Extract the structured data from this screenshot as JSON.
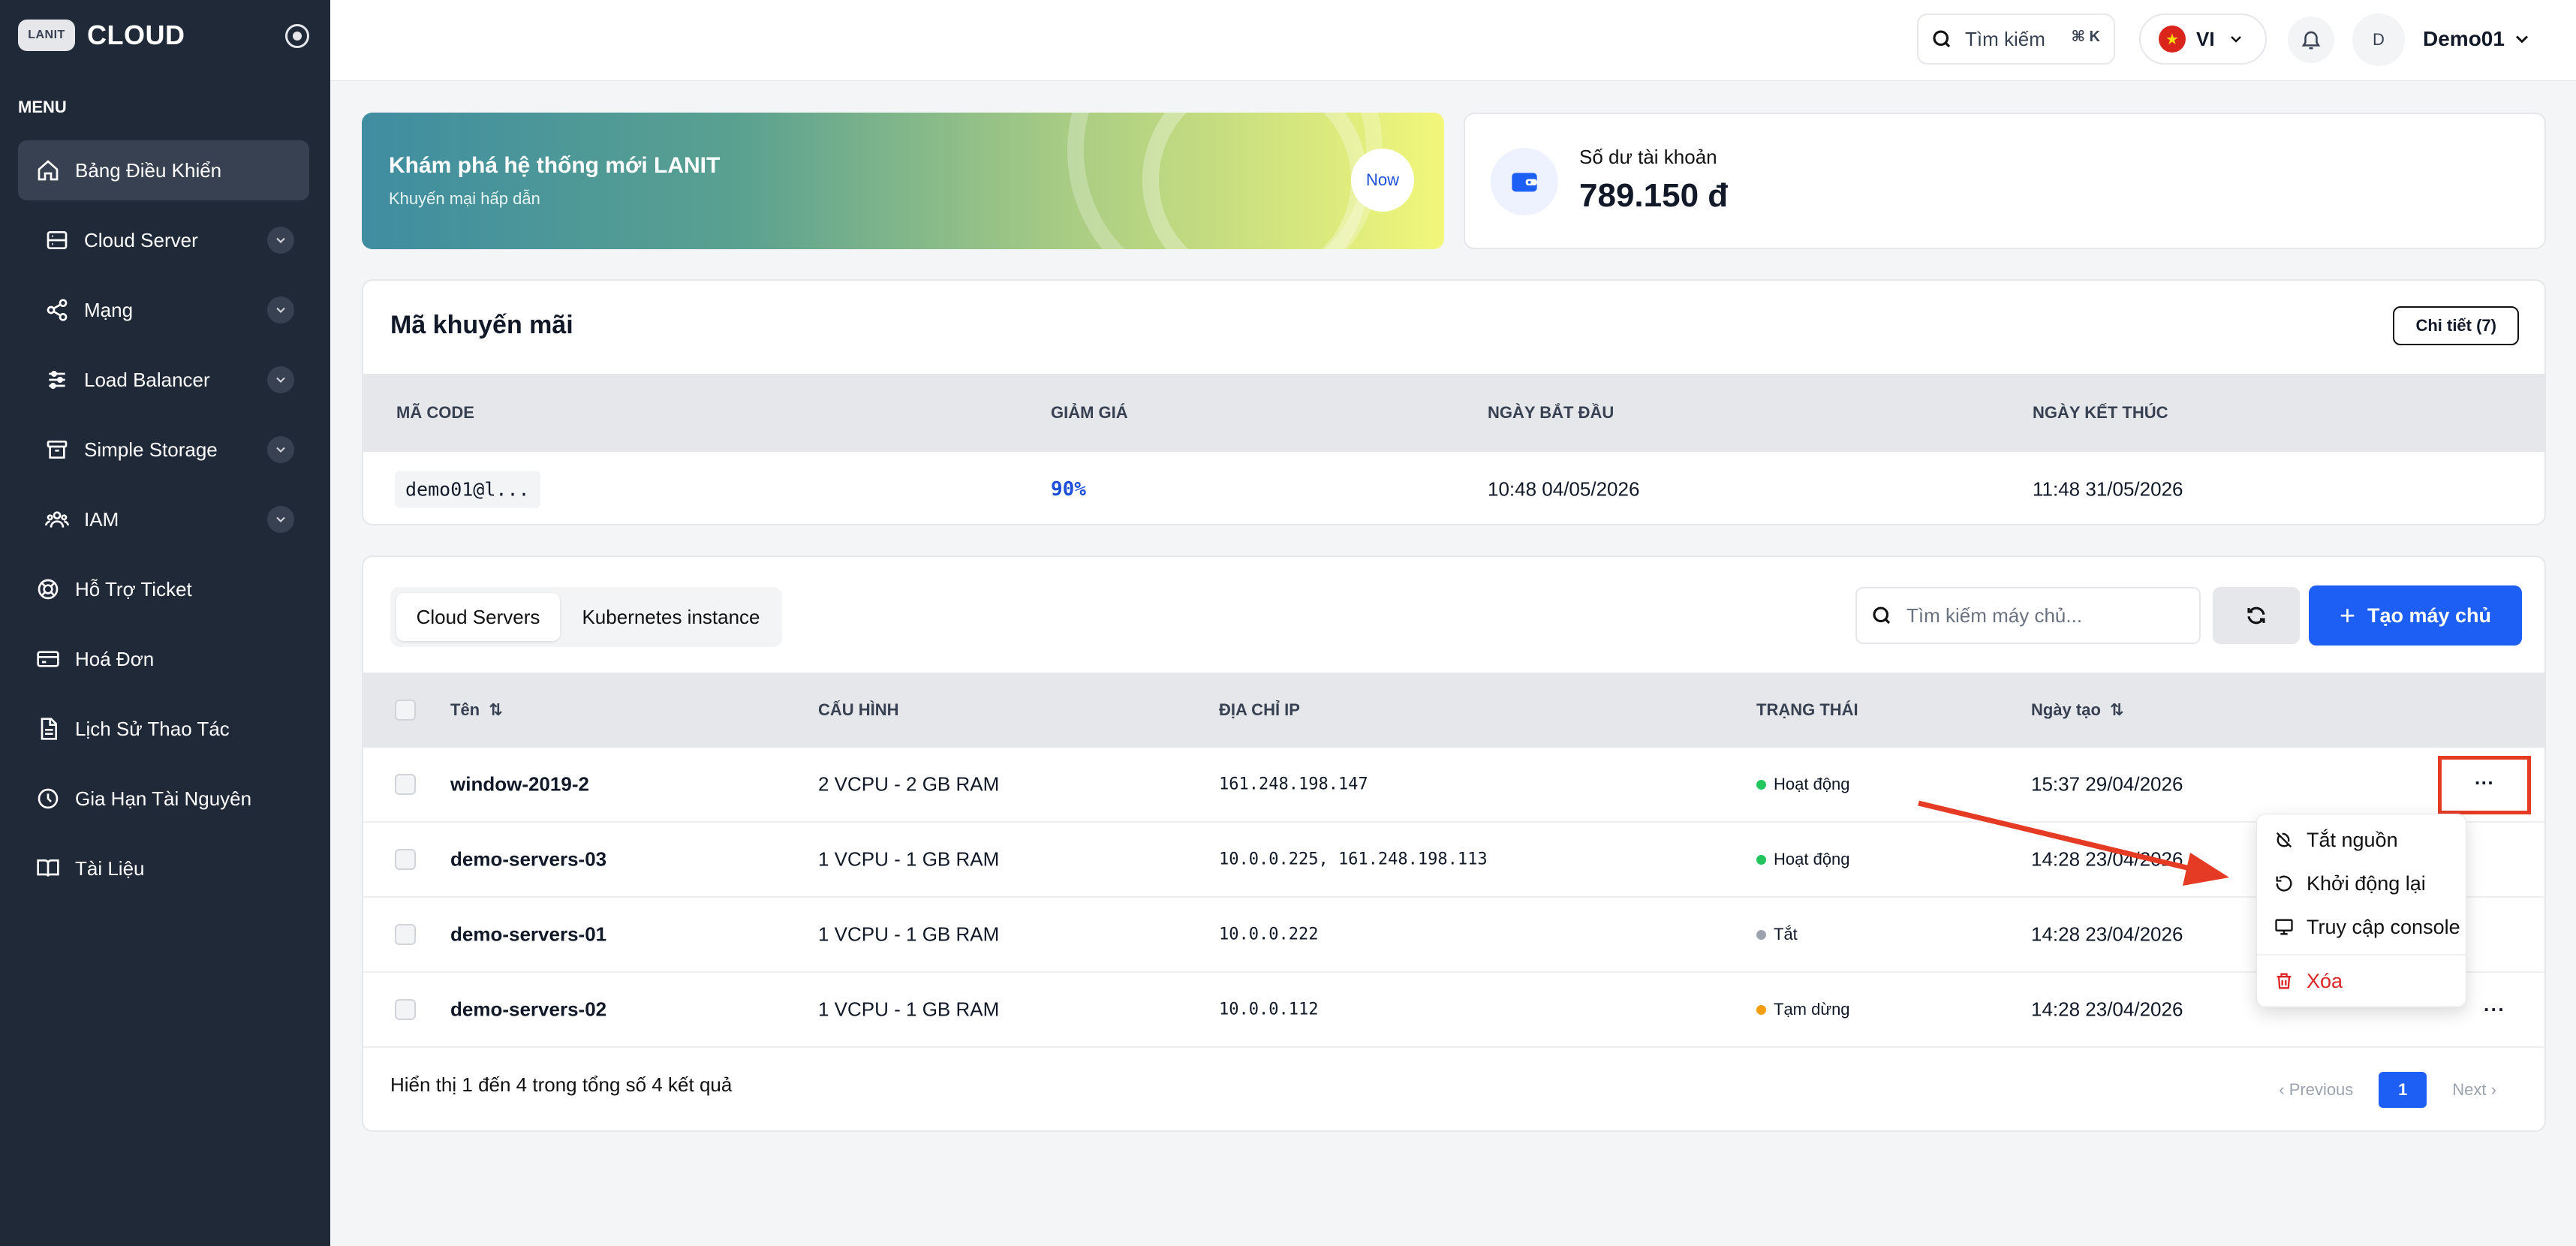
{
  "sidebar": {
    "brand_logo": "LANIT",
    "brand_name": "CLOUD",
    "menu_title": "MENU",
    "items": [
      {
        "label": "Bảng Điều Khiển",
        "icon": "home-icon"
      },
      {
        "label": "Cloud Server",
        "icon": "server-icon"
      },
      {
        "label": "Mạng",
        "icon": "share-icon"
      },
      {
        "label": "Load Balancer",
        "icon": "sliders-icon"
      },
      {
        "label": "Simple Storage",
        "icon": "archive-icon"
      },
      {
        "label": "IAM",
        "icon": "users-icon"
      },
      {
        "label": "Hỗ Trợ Ticket",
        "icon": "support-icon"
      },
      {
        "label": "Hoá Đơn",
        "icon": "credit-card-icon"
      },
      {
        "label": "Lịch Sử Thao Tác",
        "icon": "file-icon"
      },
      {
        "label": "Gia Hạn Tài Nguyên",
        "icon": "clock-icon"
      },
      {
        "label": "Tài Liệu",
        "icon": "book-icon"
      }
    ]
  },
  "header": {
    "search_label": "Tìm kiếm",
    "search_shortcut": "⌘ K",
    "language": "VI",
    "avatar_initial": "D",
    "user_name": "Demo01"
  },
  "promo": {
    "title": "Khám phá hệ thống mới LANIT",
    "subtitle": "Khuyến mại hấp dẫn",
    "button": "Now"
  },
  "balance": {
    "label": "Số dư tài khoản",
    "value": "789.150 đ"
  },
  "coupons": {
    "title": "Mã khuyến mãi",
    "detail_button": "Chi tiết (7)",
    "columns": [
      "MÃ CODE",
      "GIẢM GIÁ",
      "NGÀY BẮT ĐẦU",
      "NGÀY KẾT THÚC"
    ],
    "rows": [
      {
        "code": "demo01@l...",
        "discount": "90%",
        "start": "10:48 04/05/2026",
        "end": "11:48 31/05/2026"
      }
    ]
  },
  "servers": {
    "tabs": [
      "Cloud Servers",
      "Kubernetes instance"
    ],
    "search_placeholder": "Tìm kiếm máy chủ...",
    "create_button": "Tạo máy chủ",
    "columns": [
      "Tên",
      "CẤU HÌNH",
      "ĐỊA CHỈ IP",
      "TRẠNG THÁI",
      "Ngày tạo"
    ],
    "rows": [
      {
        "name": "window-2019-2",
        "config": "2 VCPU - 2 GB RAM",
        "ip": "161.248.198.147",
        "status": "Hoạt động",
        "created": "15:37 29/04/2026"
      },
      {
        "name": "demo-servers-03",
        "config": "1 VCPU - 1 GB RAM",
        "ip": "10.0.0.225, 161.248.198.113",
        "status": "Hoạt động",
        "created": "14:28 23/04/2026"
      },
      {
        "name": "demo-servers-01",
        "config": "1 VCPU - 1 GB RAM",
        "ip": "10.0.0.222",
        "status": "Tắt",
        "created": "14:28 23/04/2026"
      },
      {
        "name": "demo-servers-02",
        "config": "1 VCPU - 1 GB RAM",
        "ip": "10.0.0.112",
        "status": "Tạm dừng",
        "created": "14:28 23/04/2026"
      }
    ],
    "more_label": "···",
    "footer": "Hiển thị 1 đến 4 trong tổng số 4 kết quả",
    "pager": {
      "previous": "Previous",
      "page": "1",
      "next": "Next"
    }
  },
  "context_menu": {
    "items": [
      "Tắt nguồn",
      "Khởi động lại",
      "Truy cập console",
      "Xóa"
    ]
  },
  "colors": {
    "accent": "#1d5ef5",
    "status_active": "#22c55e",
    "status_off": "#9ca3af",
    "status_paused": "#f59e0b",
    "annotation": "#e53b25"
  }
}
